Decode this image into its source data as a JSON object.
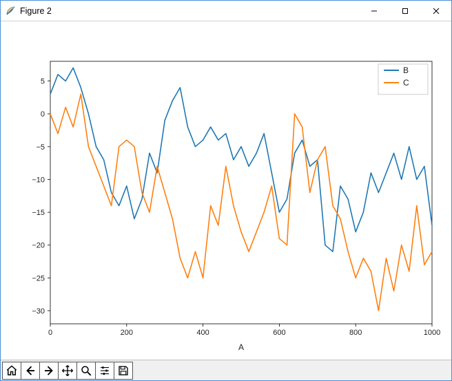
{
  "window": {
    "title": "Figure 2"
  },
  "toolbar": {
    "home": "Home",
    "back": "Back",
    "forward": "Forward",
    "pan": "Pan",
    "zoom": "Zoom",
    "configure": "Configure subplots",
    "save": "Save"
  },
  "legend": {
    "series": [
      "B",
      "C"
    ]
  },
  "xlabel": "A",
  "xticks": [
    "0",
    "200",
    "400",
    "600",
    "800",
    "1000"
  ],
  "yticks": [
    "-30",
    "-25",
    "-20",
    "-15",
    "-10",
    "-5",
    "0",
    "5"
  ],
  "chart_data": {
    "type": "line",
    "xlabel": "A",
    "ylabel": "",
    "xlim": [
      0,
      1000
    ],
    "ylim": [
      -32,
      8
    ],
    "grid": false,
    "legend_position": "upper right",
    "series": [
      {
        "name": "B",
        "color": "#1f77b4",
        "x": [
          0,
          20,
          40,
          60,
          80,
          100,
          120,
          140,
          160,
          180,
          200,
          220,
          240,
          260,
          280,
          300,
          320,
          340,
          360,
          380,
          400,
          420,
          440,
          460,
          480,
          500,
          520,
          540,
          560,
          580,
          600,
          620,
          640,
          660,
          680,
          700,
          720,
          740,
          760,
          780,
          800,
          820,
          840,
          860,
          880,
          900,
          920,
          940,
          960,
          980,
          1000
        ],
        "y": [
          3,
          6,
          5,
          7,
          4,
          0,
          -5,
          -7,
          -12,
          -14,
          -11,
          -16,
          -13,
          -6,
          -9,
          -1,
          2,
          4,
          -2,
          -5,
          -4,
          -2,
          -4,
          -3,
          -7,
          -5,
          -8,
          -6,
          -3,
          -9,
          -15,
          -13,
          -6,
          -4,
          -8,
          -7,
          -20,
          -21,
          -11,
          -13,
          -18,
          -15,
          -9,
          -12,
          -9,
          -6,
          -10,
          -5,
          -10,
          -8,
          -17
        ]
      },
      {
        "name": "C",
        "color": "#ff7f0e",
        "x": [
          0,
          20,
          40,
          60,
          80,
          100,
          120,
          140,
          160,
          180,
          200,
          220,
          240,
          260,
          280,
          300,
          320,
          340,
          360,
          380,
          400,
          420,
          440,
          460,
          480,
          500,
          520,
          540,
          560,
          580,
          600,
          620,
          640,
          660,
          680,
          700,
          720,
          740,
          760,
          780,
          800,
          820,
          840,
          860,
          880,
          900,
          920,
          940,
          960,
          980,
          1000
        ],
        "y": [
          0,
          -3,
          1,
          -2,
          3,
          -5,
          -8,
          -11,
          -14,
          -5,
          -4,
          -5,
          -12,
          -15,
          -8,
          -12,
          -16,
          -22,
          -25,
          -21,
          -25,
          -14,
          -17,
          -8,
          -14,
          -18,
          -21,
          -18,
          -15,
          -11,
          -19,
          -20,
          0,
          -2,
          -12,
          -7,
          -5,
          -14,
          -16,
          -21,
          -25,
          -22,
          -24,
          -30,
          -22,
          -27,
          -20,
          -24,
          -14,
          -23,
          -21
        ]
      }
    ]
  }
}
